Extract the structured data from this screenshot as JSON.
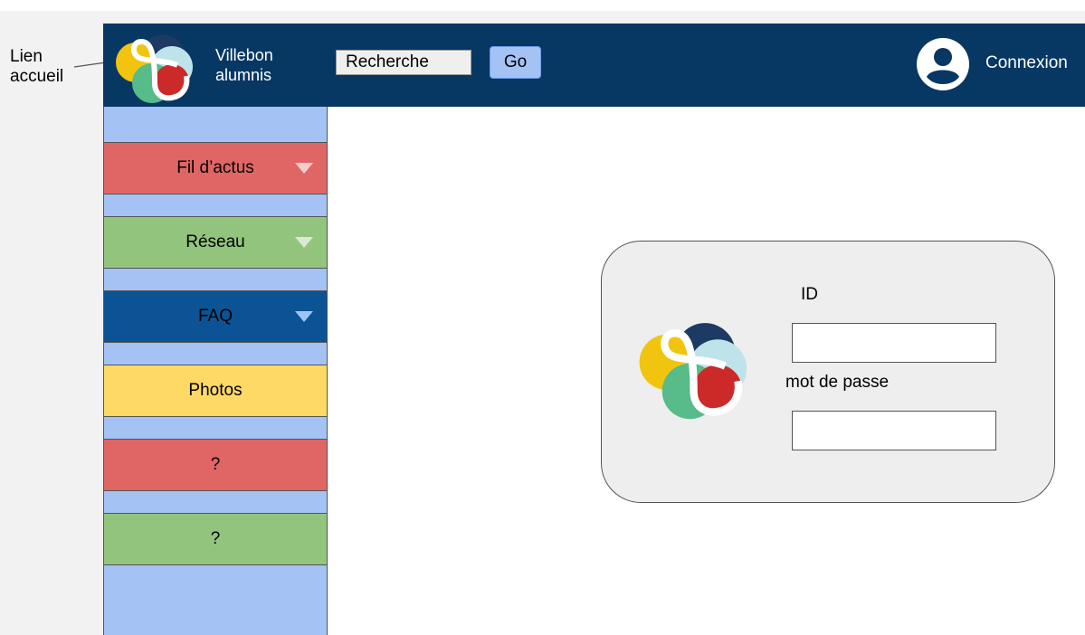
{
  "annotation": {
    "label": "Lien accueil"
  },
  "header": {
    "brand": "Villebon alumnis",
    "search": {
      "value": "Recherche",
      "placeholder": ""
    },
    "go_label": "Go",
    "connexion_label": "Connexion"
  },
  "sidebar": {
    "items": [
      {
        "label": "Fil d’actus",
        "color": "#e06666",
        "has_dropdown": true
      },
      {
        "label": "Réseau",
        "color": "#93c47d",
        "has_dropdown": true
      },
      {
        "label": "FAQ",
        "color": "#0b5394",
        "has_dropdown": true
      },
      {
        "label": "Photos",
        "color": "#ffd966",
        "has_dropdown": false
      },
      {
        "label": "?",
        "color": "#e06666",
        "has_dropdown": false
      },
      {
        "label": "?",
        "color": "#93c47d",
        "has_dropdown": false
      }
    ]
  },
  "login": {
    "id_label": "ID",
    "id_value": "",
    "password_label": "mot de passe",
    "password_value": ""
  },
  "colors": {
    "header_bg": "#073763",
    "sidebar_bg": "#a4c2f4",
    "go_button": "#a4c2f4",
    "card_bg": "#eeeeee"
  },
  "icons": {
    "logo": "clover-logo-icon",
    "user": "user-account-icon",
    "dropdown": "triangle-down-icon"
  }
}
